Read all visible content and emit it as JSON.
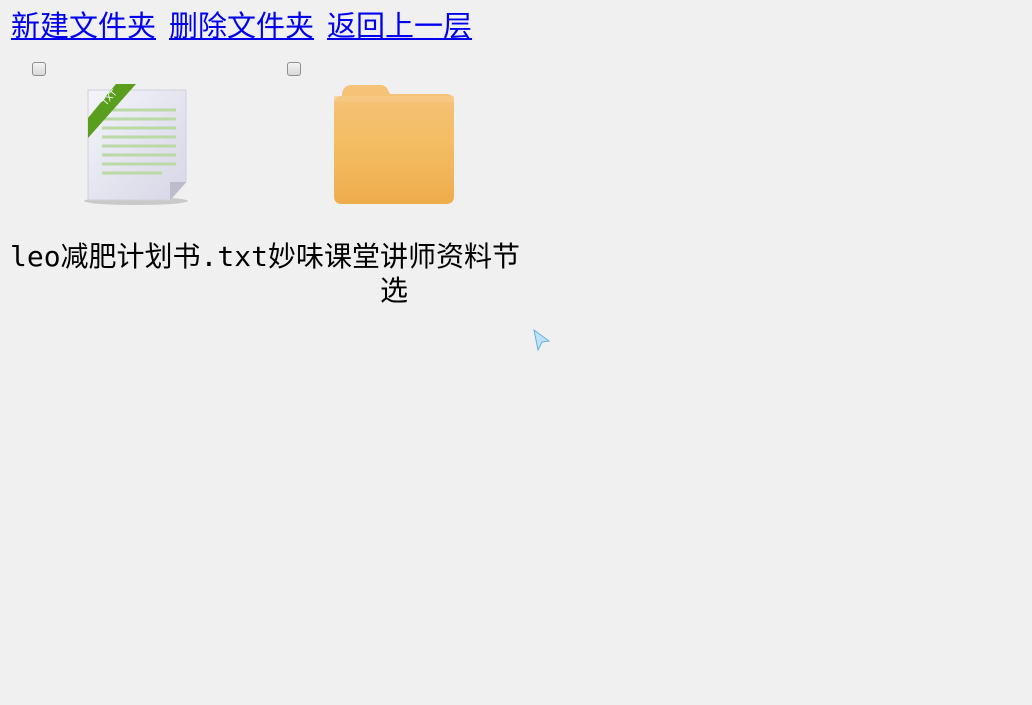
{
  "toolbar": {
    "new_folder": "新建文件夹",
    "delete_folder": "删除文件夹",
    "go_up": "返回上一层"
  },
  "files": [
    {
      "name": "leo减肥计划书.txt",
      "type": "text-file",
      "icon": "txt-file-icon",
      "ribbon_label": "TXT",
      "checked": false
    },
    {
      "name": "妙味课堂讲师资料节选",
      "type": "folder",
      "icon": "folder-icon",
      "checked": false
    }
  ],
  "colors": {
    "link": "#0000ee",
    "background": "#f0f0f0",
    "folder": "#f2b655",
    "ribbon": "#5a9e1e"
  }
}
